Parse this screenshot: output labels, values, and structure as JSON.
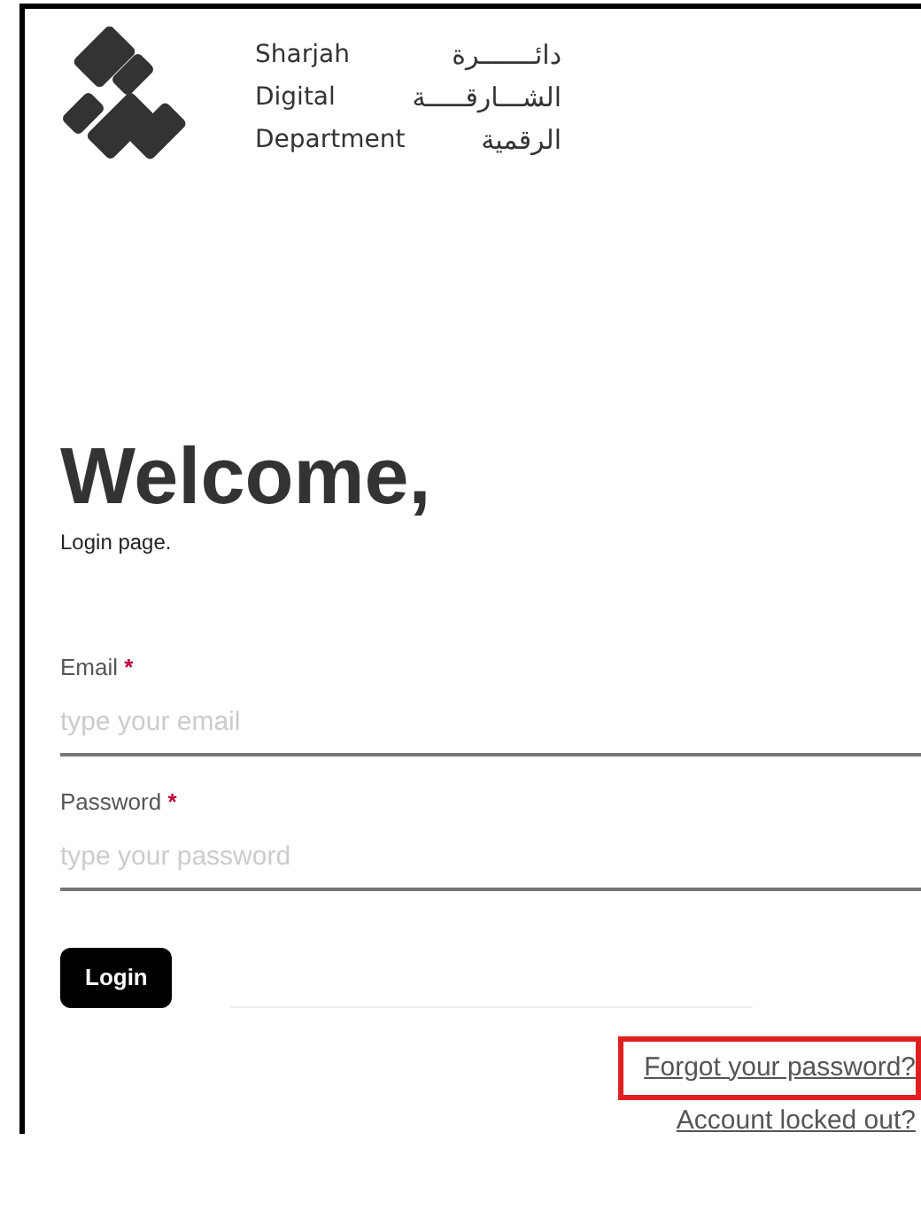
{
  "logo": {
    "english_lines": [
      "Sharjah",
      "Digital",
      "Department"
    ],
    "arabic_lines": [
      "دائـــــــرة",
      "الشـــارقـــــة",
      "الرقمية"
    ]
  },
  "heading": "Welcome,",
  "subheading": "Login page.",
  "fields": [
    {
      "label": "Email",
      "required_mark": "*",
      "placeholder": "type your email"
    },
    {
      "label": "Password",
      "required_mark": "*",
      "placeholder": "type your password"
    }
  ],
  "login_button": "Login",
  "links": [
    {
      "text": "Forgot your password?",
      "highlighted": true
    },
    {
      "text": "Account locked out?",
      "highlighted": false
    }
  ]
}
